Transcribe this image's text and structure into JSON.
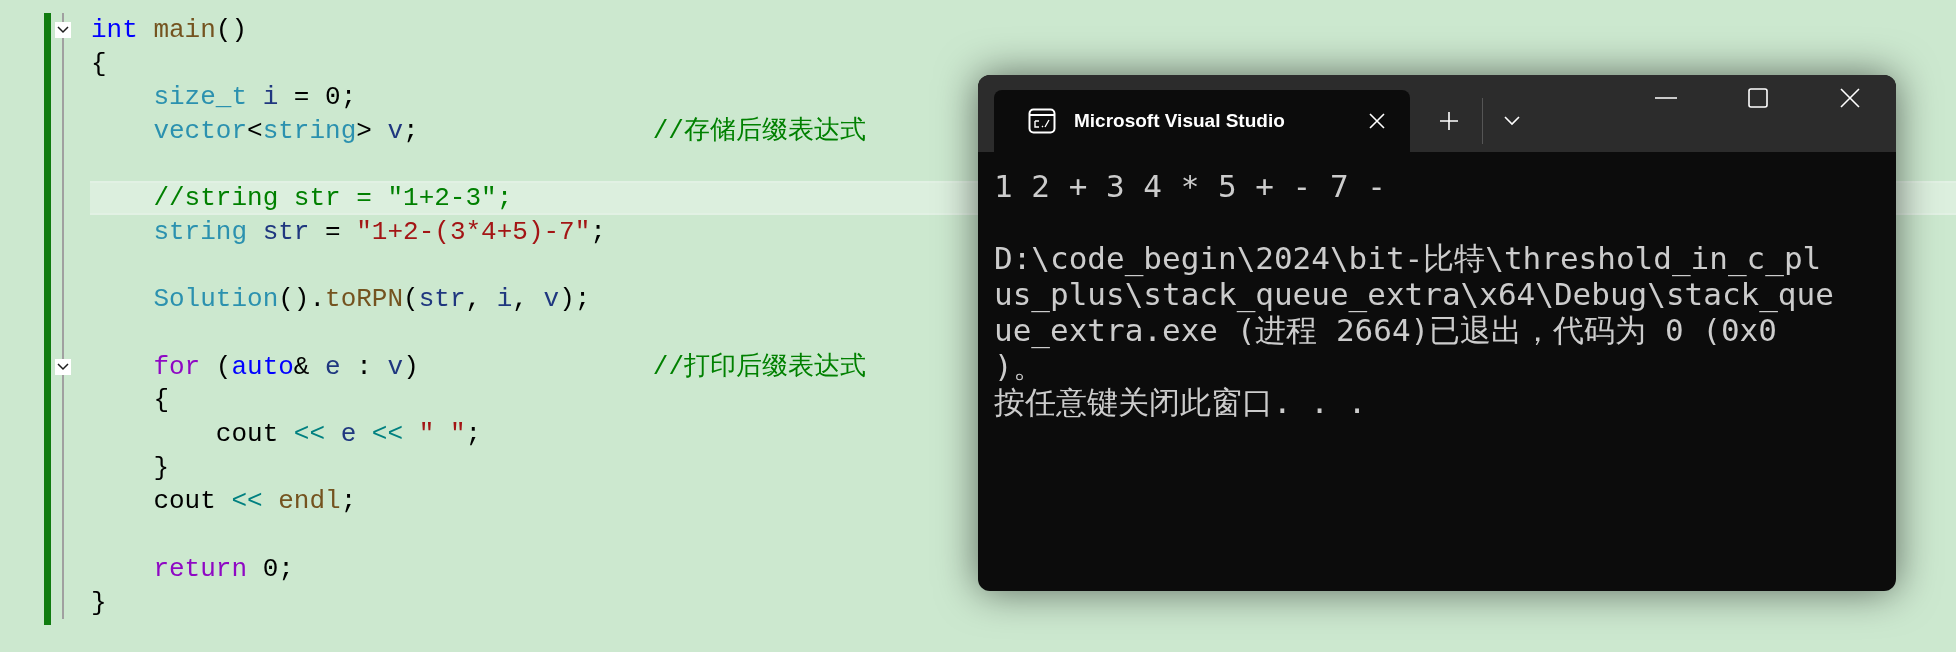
{
  "editor": {
    "lines": [
      {
        "foldable": true,
        "current": false,
        "tokens": [
          {
            "kind": "keyword",
            "text": "int"
          },
          {
            "kind": "function",
            "text": " main"
          },
          {
            "kind": "plain",
            "text": "()"
          }
        ]
      },
      {
        "foldable": false,
        "current": false,
        "tokens": [
          {
            "kind": "plain",
            "text": "{"
          }
        ]
      },
      {
        "foldable": false,
        "current": false,
        "tokens": [
          {
            "kind": "type",
            "text": "    size_t"
          },
          {
            "kind": "variable",
            "text": " i"
          },
          {
            "kind": "plain",
            "text": " = 0;"
          }
        ]
      },
      {
        "foldable": false,
        "current": false,
        "tokens": [
          {
            "kind": "type",
            "text": "    vector"
          },
          {
            "kind": "plain",
            "text": "<"
          },
          {
            "kind": "type",
            "text": "string"
          },
          {
            "kind": "plain",
            "text": ">"
          },
          {
            "kind": "variable",
            "text": " v"
          },
          {
            "kind": "plain",
            "text": ";"
          },
          {
            "kind": "comment",
            "text": "               //存储后缀表达式"
          }
        ]
      },
      {
        "foldable": false,
        "current": false
      },
      {
        "foldable": false,
        "current": true,
        "tokens": [
          {
            "kind": "comment",
            "text": "    //string str = \"1+2-3\";"
          }
        ]
      },
      {
        "foldable": false,
        "current": false,
        "tokens": [
          {
            "kind": "type",
            "text": "    string"
          },
          {
            "kind": "variable",
            "text": " str"
          },
          {
            "kind": "plain",
            "text": " = "
          },
          {
            "kind": "string",
            "text": "\"1+2-(3*4+5)-7\""
          },
          {
            "kind": "plain",
            "text": ";"
          }
        ]
      },
      {
        "foldable": false,
        "current": false
      },
      {
        "foldable": false,
        "current": false,
        "tokens": [
          {
            "kind": "type",
            "text": "    Solution"
          },
          {
            "kind": "plain",
            "text": "()."
          },
          {
            "kind": "function",
            "text": "toRPN"
          },
          {
            "kind": "plain",
            "text": "("
          },
          {
            "kind": "variable",
            "text": "str"
          },
          {
            "kind": "plain",
            "text": ", "
          },
          {
            "kind": "variable",
            "text": "i"
          },
          {
            "kind": "plain",
            "text": ", "
          },
          {
            "kind": "variable",
            "text": "v"
          },
          {
            "kind": "plain",
            "text": ");"
          }
        ]
      },
      {
        "foldable": false,
        "current": false
      },
      {
        "foldable": true,
        "current": false,
        "tokens": [
          {
            "kind": "control",
            "text": "    for"
          },
          {
            "kind": "plain",
            "text": " ("
          },
          {
            "kind": "keyword",
            "text": "auto"
          },
          {
            "kind": "plain",
            "text": "&"
          },
          {
            "kind": "variable",
            "text": " e"
          },
          {
            "kind": "plain",
            "text": " :"
          },
          {
            "kind": "variable",
            "text": " v"
          },
          {
            "kind": "plain",
            "text": ")"
          },
          {
            "kind": "comment",
            "text": "               //打印后缀表达式"
          }
        ]
      },
      {
        "foldable": false,
        "current": false,
        "tokens": [
          {
            "kind": "plain",
            "text": "    {"
          }
        ]
      },
      {
        "foldable": false,
        "current": false,
        "tokens": [
          {
            "kind": "plain",
            "text": "        cout"
          },
          {
            "kind": "operator",
            "text": " <<"
          },
          {
            "kind": "variable",
            "text": " e"
          },
          {
            "kind": "operator",
            "text": " <<"
          },
          {
            "kind": "string",
            "text": " \" \""
          },
          {
            "kind": "plain",
            "text": ";"
          }
        ]
      },
      {
        "foldable": false,
        "current": false,
        "tokens": [
          {
            "kind": "plain",
            "text": "    }"
          }
        ]
      },
      {
        "foldable": false,
        "current": false,
        "tokens": [
          {
            "kind": "plain",
            "text": "    cout"
          },
          {
            "kind": "operator",
            "text": " <<"
          },
          {
            "kind": "function",
            "text": " endl"
          },
          {
            "kind": "plain",
            "text": ";"
          }
        ]
      },
      {
        "foldable": false,
        "current": false
      },
      {
        "foldable": false,
        "current": false,
        "tokens": [
          {
            "kind": "control",
            "text": "    return"
          },
          {
            "kind": "plain",
            "text": " 0;"
          }
        ]
      },
      {
        "foldable": false,
        "current": false,
        "tokens": [
          {
            "kind": "plain",
            "text": "}"
          }
        ]
      }
    ]
  },
  "console": {
    "tab": {
      "title": "Microsoft Visual Studio",
      "selected": true
    },
    "lines": [
      {
        "text": "1 2 + 3 4 * 5 + - 7 -",
        "blank_before": false
      },
      {
        "text": "D:\\code_begin\\2024\\bit-比特\\threshold_in_c_pl",
        "blank_before": true
      },
      {
        "text": "us_plus\\stack_queue_extra\\x64\\Debug\\stack_que",
        "blank_before": false
      },
      {
        "text": "ue_extra.exe (进程 2664)已退出，代码为 0 (0x0",
        "blank_before": false
      },
      {
        "text": ")。",
        "blank_before": false
      },
      {
        "text": "按任意键关闭此窗口. . .",
        "blank_before": false
      }
    ]
  }
}
